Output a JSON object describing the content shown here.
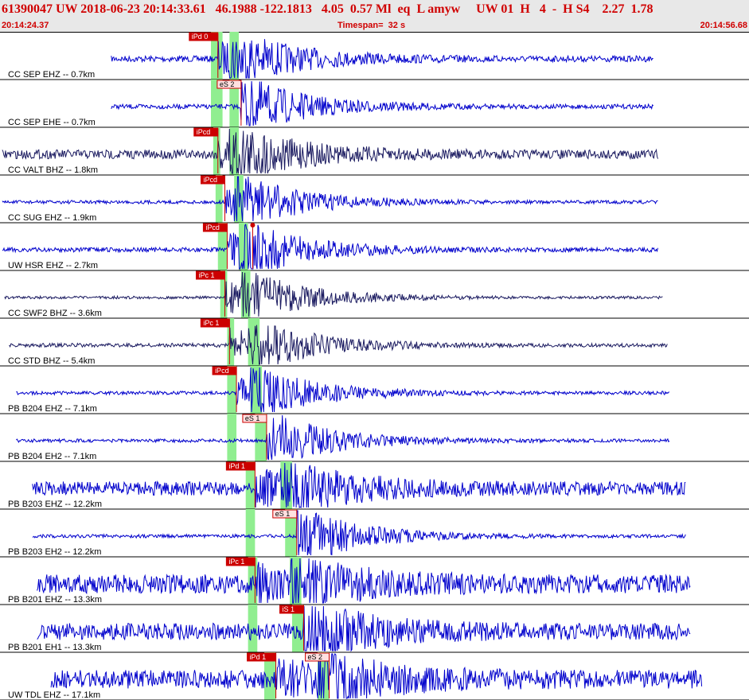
{
  "header": {
    "title": "61390047 UW 2018-06-23 20:14:33.61   46.1988 -122.1813   4.05  0.57 Ml  eq  L amyw     UW 01  H   4  -  H S4    2.27  1.78",
    "start_time": "20:14:24.37",
    "timespan": "Timespan=  32 s",
    "end_time": "20:14:56.68"
  },
  "chart_data": {
    "type": "line",
    "title": "",
    "xlabel": "",
    "ylabel": "",
    "x_unit": "s",
    "xlim": [
      0,
      32.31
    ],
    "colors": {
      "trace": "#0000cc",
      "trace_dark": "#1a1a60",
      "pick": "#cc0000",
      "window": "#90ee90"
    },
    "traces": [
      {
        "label": "CC SEP EHZ -- 0.7km",
        "dark": false,
        "noise": 0.12,
        "start": 4.8,
        "end": 28.2,
        "picks": [
          {
            "label": "iPd 0",
            "t": 9.4
          }
        ],
        "windows": [
          [
            9.1,
            9.6
          ],
          [
            9.9,
            10.3
          ]
        ]
      },
      {
        "label": "CC SEP EHE -- 0.7km",
        "dark": false,
        "noise": 0.08,
        "start": 4.8,
        "end": 28.2,
        "picks": [
          {
            "label": "eS 2",
            "t": 10.4
          }
        ],
        "windows": [
          [
            9.1,
            9.6
          ],
          [
            9.9,
            10.3
          ]
        ]
      },
      {
        "label": "CC VALT BHZ -- 1.8km",
        "dark": true,
        "noise": 0.2,
        "start": 0.1,
        "end": 28.4,
        "picks": [
          {
            "label": "iPcd",
            "t": 9.4
          }
        ],
        "windows": [
          [
            9.2,
            9.5
          ],
          [
            9.9,
            10.3
          ]
        ]
      },
      {
        "label": "CC SUG EHZ -- 1.9km",
        "dark": false,
        "noise": 0.05,
        "start": 0.1,
        "end": 28.4,
        "picks": [
          {
            "label": "iPcd",
            "t": 9.7
          }
        ],
        "windows": [
          [
            9.3,
            9.6
          ],
          [
            10.1,
            10.5
          ]
        ]
      },
      {
        "label": "UW HSR EHZ -- 2.7km",
        "dark": false,
        "noise": 0.08,
        "start": 0.1,
        "end": 28.4,
        "picks": [
          {
            "label": "iPcd",
            "t": 9.8
          },
          {
            "label": "",
            "t": 10.9
          }
        ],
        "windows": [
          [
            9.4,
            9.8
          ],
          [
            10.3,
            10.7
          ]
        ]
      },
      {
        "label": "CC SWF2 BHZ -- 3.6km",
        "dark": true,
        "noise": 0.03,
        "start": 0.2,
        "end": 28.6,
        "picks": [
          {
            "label": "iPc 1",
            "t": 9.7
          }
        ],
        "windows": [
          [
            9.5,
            9.8
          ],
          [
            10.4,
            10.8
          ]
        ]
      },
      {
        "label": "CC STD BHZ -- 5.4km",
        "dark": true,
        "noise": 0.06,
        "start": 0.4,
        "end": 28.8,
        "picks": [
          {
            "label": "iPc 1",
            "t": 9.9
          }
        ],
        "windows": [
          [
            9.8,
            10.1
          ],
          [
            10.7,
            11.2
          ]
        ]
      },
      {
        "label": "PB B204 EHZ -- 7.1km",
        "dark": false,
        "noise": 0.05,
        "start": 0.7,
        "end": 28.9,
        "picks": [
          {
            "label": "iPcd",
            "t": 10.2
          }
        ],
        "windows": [
          [
            9.8,
            10.2
          ],
          [
            10.8,
            11.3
          ]
        ]
      },
      {
        "label": "PB B204 EH2 -- 7.1km",
        "dark": false,
        "noise": 0.05,
        "start": 0.7,
        "end": 28.9,
        "picks": [
          {
            "label": "eS 1",
            "t": 11.5
          }
        ],
        "windows": [
          [
            9.8,
            10.2
          ],
          [
            11.0,
            11.5
          ]
        ]
      },
      {
        "label": "PB B203 EHZ -- 12.2km",
        "dark": false,
        "noise": 0.32,
        "start": 1.4,
        "end": 29.6,
        "picks": [
          {
            "label": "iPd 1",
            "t": 11.0
          }
        ],
        "windows": [
          [
            10.6,
            11.0
          ],
          [
            12.1,
            12.6
          ]
        ]
      },
      {
        "label": "PB B203 EH2 -- 12.2km",
        "dark": false,
        "noise": 0.05,
        "start": 1.4,
        "end": 29.6,
        "picks": [
          {
            "label": "eS 1",
            "t": 12.8
          }
        ],
        "windows": [
          [
            10.6,
            11.0
          ],
          [
            12.3,
            12.8
          ]
        ]
      },
      {
        "label": "PB B201 EHZ -- 13.3km",
        "dark": false,
        "noise": 0.45,
        "start": 1.6,
        "end": 29.8,
        "picks": [
          {
            "label": "iPc 1",
            "t": 11.0
          }
        ],
        "windows": [
          [
            10.7,
            11.1
          ],
          [
            12.5,
            13.0
          ]
        ]
      },
      {
        "label": "PB B201 EH1 -- 13.3km",
        "dark": false,
        "noise": 0.4,
        "start": 1.6,
        "end": 29.8,
        "picks": [
          {
            "label": "iS 1",
            "t": 13.1
          }
        ],
        "windows": [
          [
            10.7,
            11.1
          ],
          [
            12.6,
            13.1
          ]
        ]
      },
      {
        "label": "UW TDL EHZ -- 17.1km",
        "dark": false,
        "noise": 0.45,
        "start": 2.2,
        "end": 30.3,
        "picks": [
          {
            "label": "iPd 1",
            "t": 11.9
          },
          {
            "label": "eS 2",
            "t": 14.2
          }
        ],
        "windows": [
          [
            11.4,
            11.9
          ],
          [
            13.7,
            14.2
          ]
        ]
      }
    ]
  }
}
